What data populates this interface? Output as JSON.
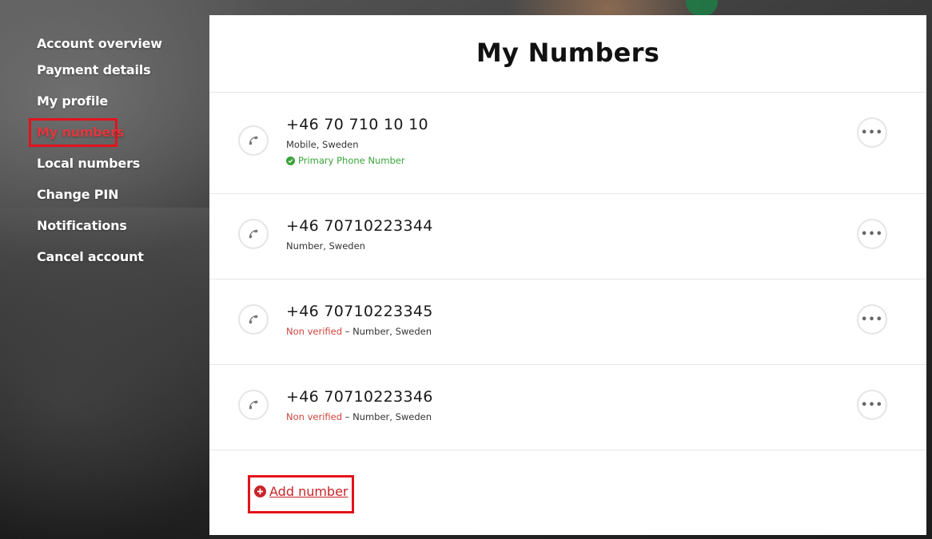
{
  "sidebar": {
    "items": [
      {
        "label": "Account overview"
      },
      {
        "label": "Payment details"
      },
      {
        "label": "My profile"
      },
      {
        "label": "My numbers"
      },
      {
        "label": "Local numbers"
      },
      {
        "label": "Change PIN"
      },
      {
        "label": "Notifications"
      },
      {
        "label": "Cancel account"
      }
    ],
    "active_index": 3
  },
  "main": {
    "title": "My Numbers",
    "numbers": [
      {
        "number": "+46 70 710 10 10",
        "status": "",
        "separator": "",
        "detail": "Mobile, Sweden",
        "primary_label": "Primary Phone Number",
        "more_label": "•••"
      },
      {
        "number": "+46 70710223344",
        "status": "",
        "separator": "",
        "detail": "Number, Sweden",
        "primary_label": "",
        "more_label": "•••"
      },
      {
        "number": "+46 70710223345",
        "status": "Non verified",
        "separator": " – ",
        "detail": "Number, Sweden",
        "primary_label": "",
        "more_label": "•••"
      },
      {
        "number": "+46 70710223346",
        "status": "Non verified",
        "separator": " – ",
        "detail": "Number, Sweden",
        "primary_label": "",
        "more_label": "•••"
      }
    ],
    "add_label": " Add number"
  },
  "colors": {
    "accent_red": "#c8232a",
    "highlight_red": "#e3131b",
    "verified_green": "#3aa33a",
    "warning_red": "#d0453e"
  },
  "icons": {
    "phone": "phone-icon",
    "more": "more-options-icon",
    "check": "check-circle-icon",
    "add": "plus-circle-icon"
  }
}
